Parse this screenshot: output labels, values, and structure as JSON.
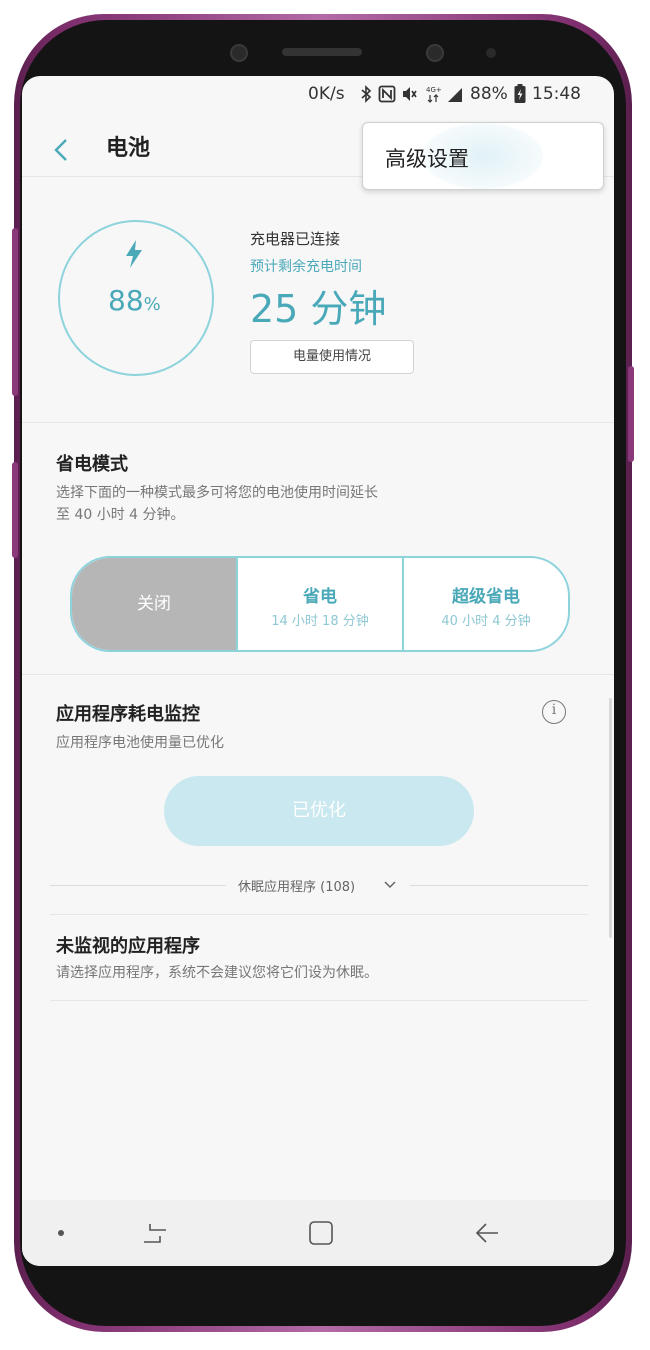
{
  "status_bar": {
    "speed": "0K/s",
    "battery": "88%",
    "time": "15:48"
  },
  "header": {
    "title": "电池"
  },
  "popup_menu": {
    "item": "高级设置"
  },
  "battery": {
    "percent_value": "88",
    "percent_sign": "%",
    "charger_status": "充电器已连接",
    "estimate_label": "预计剩余充电时间",
    "remaining_time": "25 分钟",
    "usage_button": "电量使用情况"
  },
  "power_saving": {
    "title": "省电模式",
    "description_line1": "选择下面的一种模式最多可将您的电池使用时间延长",
    "description_line2": "至 40 小时 4 分钟。",
    "modes": [
      {
        "name": "关闭"
      },
      {
        "name": "省电",
        "time": "14 小时 18 分钟"
      },
      {
        "name": "超级省电",
        "time": "40 小时 4 分钟"
      }
    ]
  },
  "app_monitor": {
    "title": "应用程序耗电监控",
    "description": "应用程序电池使用量已优化",
    "optimize_button": "已优化",
    "sleeping_apps": "休眠应用程序 (108)"
  },
  "unmonitored": {
    "title": "未监视的应用程序",
    "description": "请选择应用程序，系统不会建议您将它们设为休眠。"
  },
  "colors": {
    "accent": "#4aa9b8",
    "accent_light": "#8dd3dc",
    "chassis": "#7d2d6c"
  }
}
